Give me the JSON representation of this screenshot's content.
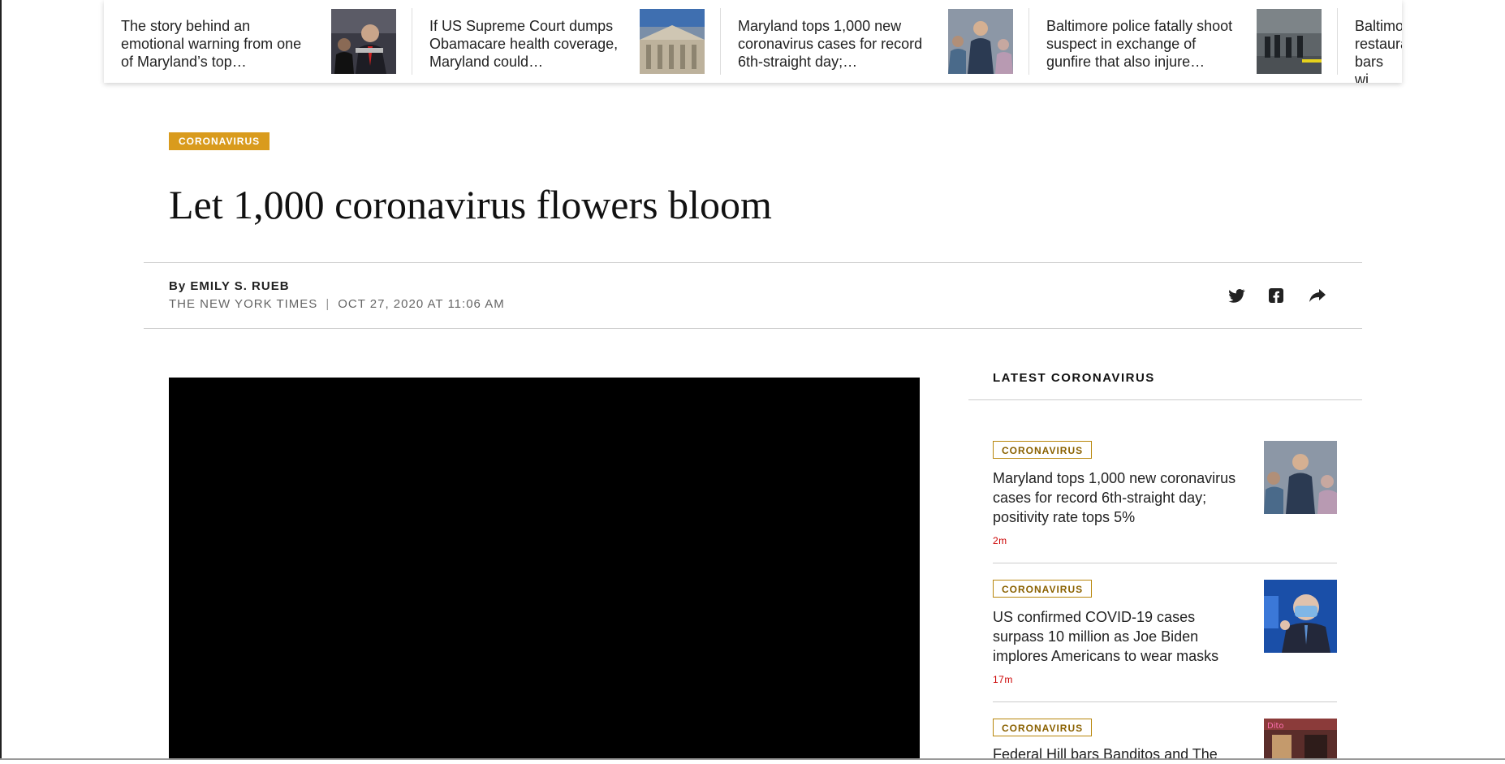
{
  "strip": {
    "items": [
      {
        "text": "The story behind an emotional warning from one of Maryland’s top…"
      },
      {
        "text": "If US Supreme Court dumps Obamacare health coverage, Maryland could…"
      },
      {
        "text": "Maryland tops 1,000 new coronavirus cases for record 6th-straight day;…"
      },
      {
        "text": "Baltimore police fatally shoot suspect in exchange of gunfire that also injure…"
      },
      {
        "text": "Baltimore restaurants bars wi…"
      }
    ]
  },
  "article": {
    "section": "CORONAVIRUS",
    "headline": "Let 1,000 coronavirus flowers bloom",
    "by_prefix": "By",
    "author": "EMILY S. RUEB",
    "source": "THE NEW YORK TIMES",
    "separator": "|",
    "date": "OCT 27, 2020 AT 11:06 AM"
  },
  "share": {
    "icons": [
      "twitter-icon",
      "facebook-icon",
      "share-arrow-icon"
    ]
  },
  "sidebar": {
    "title": "LATEST CORONAVIRUS",
    "cards": [
      {
        "tag": "CORONAVIRUS",
        "title": "Maryland tops 1,000 new coronavirus cases for record 6th-straight day; positivity rate tops 5%",
        "time": "2m"
      },
      {
        "tag": "CORONAVIRUS",
        "title": "US confirmed COVID-19 cases surpass 10 million as Joe Biden implores Americans to wear masks",
        "time": "17m"
      },
      {
        "tag": "CORONAVIRUS",
        "title": "Federal Hill bars Banditos and The",
        "time": ""
      }
    ]
  },
  "colors": {
    "kicker_bg": "#d99b1d",
    "tag_border": "#b8860b",
    "time_red": "#cc0000",
    "video_bg": "#000000"
  }
}
